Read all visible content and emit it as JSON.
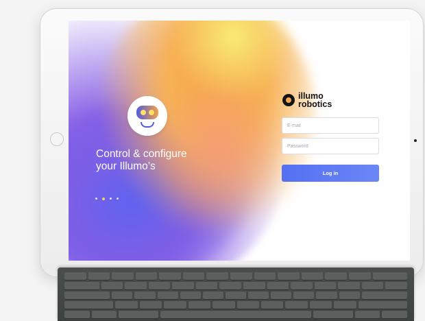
{
  "app": {
    "brand_line1": "illumo",
    "brand_line2": "robotics"
  },
  "hero": {
    "headline_line1": "Control & configure",
    "headline_line2": "your Illumo’s",
    "carousel_total": 4,
    "carousel_active": 2
  },
  "login": {
    "email_placeholder": "E-mail",
    "password_placeholder": "Password",
    "submit_label": "Log in"
  },
  "colors": {
    "accent": "#5570f2",
    "gradient_purple": "#6a5cf0",
    "gradient_orange": "#f7a64b",
    "gradient_yellow": "#f8ec76",
    "carousel_active_dot": "#ffe24c"
  },
  "icons": [
    "robot-avatar-icon",
    "illumo-logo-icon"
  ]
}
